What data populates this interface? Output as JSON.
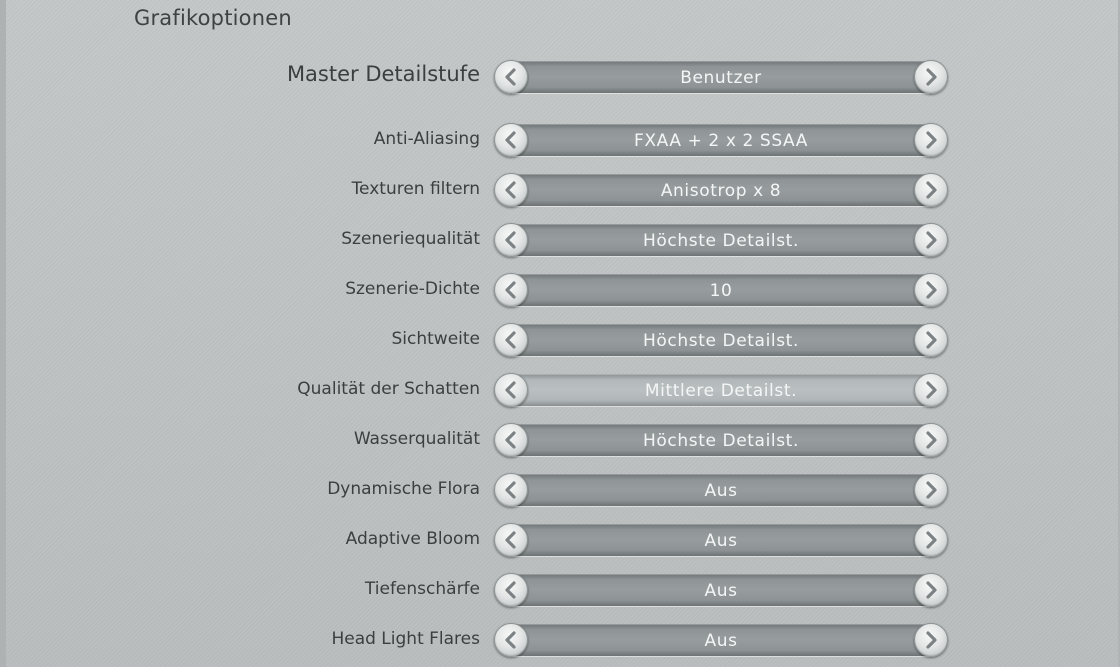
{
  "section_title": "Grafikoptionen",
  "settings": [
    {
      "label": "Master Detailstufe",
      "value": "Benutzer"
    },
    {
      "label": "Anti-Aliasing",
      "value": "FXAA + 2 x 2 SSAA"
    },
    {
      "label": "Texturen filtern",
      "value": "Anisotrop x 8"
    },
    {
      "label": "Szeneriequalität",
      "value": "Höchste Detailst."
    },
    {
      "label": "Szenerie-Dichte",
      "value": "10"
    },
    {
      "label": "Sichtweite",
      "value": "Höchste Detailst."
    },
    {
      "label": "Qualität der Schatten",
      "value": "Mittlere Detailst."
    },
    {
      "label": "Wasserqualität",
      "value": "Höchste Detailst."
    },
    {
      "label": "Dynamische Flora",
      "value": "Aus"
    },
    {
      "label": "Adaptive Bloom",
      "value": "Aus"
    },
    {
      "label": "Tiefenschärfe",
      "value": "Aus"
    },
    {
      "label": "Head Light Flares",
      "value": "Aus"
    }
  ],
  "icons": {
    "previous": "chevron-left-icon",
    "next": "chevron-right-icon"
  },
  "selected_row": "Qualität der Schatten"
}
